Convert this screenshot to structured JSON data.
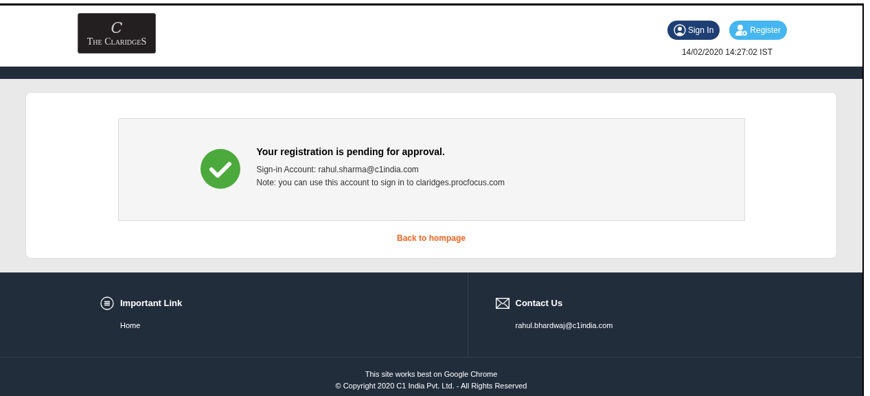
{
  "header": {
    "logo": {
      "monogram": "C",
      "name": "The ClaridgeS"
    },
    "buttons": [
      {
        "kind": "signin",
        "label": "Sign In"
      },
      {
        "kind": "register",
        "label": "Register"
      }
    ],
    "datetime": "14/02/2020 14:27:02 IST"
  },
  "message": {
    "title": "Your registration is pending for approval.",
    "lines": [
      "Sign-in Account: rahul.sharma@c1india.com",
      "Note: you can use this account to sign in to claridges.procfocus.com"
    ],
    "link": "Back to hompage"
  },
  "footer": {
    "columns": [
      {
        "kind": "links",
        "title": "Important Link",
        "items": [
          "Home"
        ]
      },
      {
        "kind": "contact",
        "title": "Contact Us",
        "items": [
          "rahul.bhardwaj@c1india.com"
        ]
      }
    ],
    "notes": [
      "This site works best on Google Chrome",
      "© Copyright 2020 C1 India Pvt. Ltd. - All Rights Reserved"
    ]
  }
}
